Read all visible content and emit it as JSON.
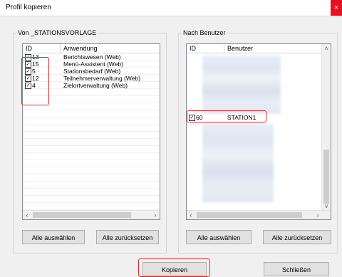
{
  "window": {
    "title": "Profil kopieren",
    "close_glyph": "×"
  },
  "left_group": {
    "title": "Von _STATIONSVORLAGE",
    "columns": {
      "id": "ID",
      "app": "Anwendung"
    },
    "rows": [
      {
        "id": "13",
        "app": "Berichtswesen (Web)",
        "checked": true
      },
      {
        "id": "15",
        "app": "Menü-Assistent (Web)",
        "checked": true
      },
      {
        "id": "5",
        "app": "Stationsbedarf (Web)",
        "checked": true
      },
      {
        "id": "12",
        "app": "Teilnehmerverwaltung (Web)",
        "checked": true
      },
      {
        "id": "4",
        "app": "Zielortverwaltung (Web)",
        "checked": true
      }
    ],
    "select_all": "Alle auswählen",
    "reset_all": "Alle zurücksetzen"
  },
  "right_group": {
    "title": "Nach Benutzer",
    "columns": {
      "id": "ID",
      "user": "Benutzer"
    },
    "selected_row": {
      "id": "60",
      "user": "STATION1",
      "checked": true
    },
    "select_all": "Alle auswählen",
    "reset_all": "Alle zurücksetzen"
  },
  "footer": {
    "copy": "Kopieren",
    "close": "Schließen"
  },
  "glyphs": {
    "check": "✓",
    "left": "‹",
    "right": "›",
    "up": "˄",
    "down": "˅"
  },
  "colors": {
    "highlight": "#e0262a",
    "close": "#e81123"
  }
}
